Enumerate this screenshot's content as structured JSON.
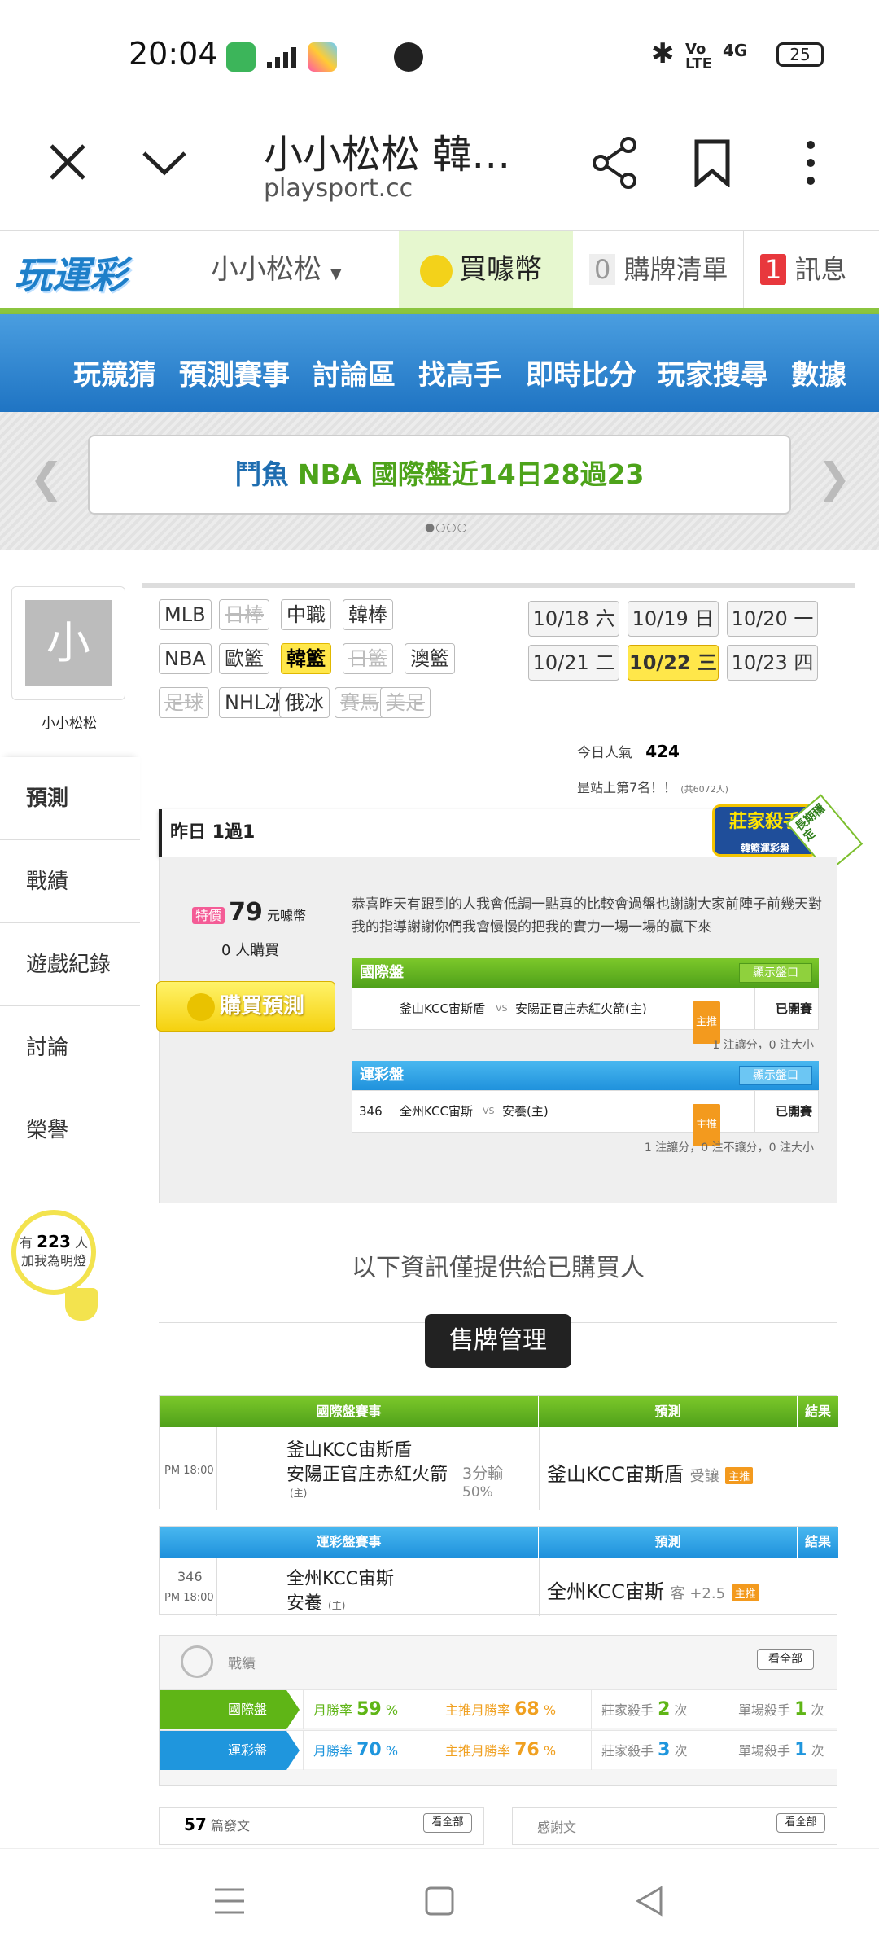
{
  "status": {
    "time": "20:04",
    "battery": "25",
    "net": "4G"
  },
  "chrome": {
    "title": "小小松松 韓…",
    "url": "playsport.cc"
  },
  "site": {
    "logo": "玩運彩",
    "username": "小小松松",
    "buy_coin": "買噱幣",
    "cart_count": "0",
    "cart_label": "購牌清單",
    "msg_count": "1",
    "msg_label": "訊息"
  },
  "nav": [
    "玩競猜",
    "預測賽事",
    "討論區",
    "找高手",
    "即時比分",
    "玩家搜尋",
    "數據"
  ],
  "promo": {
    "left": "鬥魚",
    "right": "NBA 國際盤近14日28過23"
  },
  "profile": {
    "avatar": "小",
    "name": "小小松松",
    "fans_prefix": "有",
    "fans_count": "223",
    "fans_unit": "人",
    "fans_line2": "加我為明燈"
  },
  "tabs": [
    "預測",
    "戰績",
    "遊戲紀錄",
    "討論",
    "榮譽"
  ],
  "sports": [
    {
      "label": "MLB",
      "state": "normal"
    },
    {
      "label": "日棒",
      "state": "off"
    },
    {
      "label": "中職",
      "state": "normal"
    },
    {
      "label": "韓棒",
      "state": "normal"
    },
    {
      "label": "NBA",
      "state": "normal"
    },
    {
      "label": "歐籃",
      "state": "normal"
    },
    {
      "label": "韓籃",
      "state": "on"
    },
    {
      "label": "日籃",
      "state": "off"
    },
    {
      "label": "澳籃",
      "state": "normal"
    },
    {
      "label": "足球",
      "state": "off"
    },
    {
      "label": "NHL冰球",
      "state": "normal"
    },
    {
      "label": "俄冰",
      "state": "normal"
    },
    {
      "label": "賽馬",
      "state": "off"
    },
    {
      "label": "美足",
      "state": "off"
    }
  ],
  "dates": [
    {
      "label": "10/18 六",
      "state": "normal"
    },
    {
      "label": "10/19 日",
      "state": "normal"
    },
    {
      "label": "10/20 一",
      "state": "normal"
    },
    {
      "label": "10/21 二",
      "state": "normal"
    },
    {
      "label": "10/22 三",
      "state": "on"
    },
    {
      "label": "10/23 四",
      "state": "normal"
    }
  ],
  "popularity": {
    "label": "今日人氣",
    "value": "424",
    "rank_text": "昰站上第7名！！",
    "rank_total": "(共6072人)"
  },
  "yesterday": {
    "label": "昨日 1過1",
    "badge": "莊家殺手",
    "badge_sub": "韓籃運彩盤",
    "ribbon": "長期穩定"
  },
  "offer": {
    "special": "特價",
    "price": "79",
    "unit": "元噱幣",
    "buyers": "0",
    "buyers_unit": "人購買",
    "buy_btn": "購買預測"
  },
  "message": "恭喜昨天有跟到的人我會低調一點真的比較會過盤也謝謝大家前陣子前幾天對我的指導謝謝你們我會慢慢的把我的實力一場一場的贏下來",
  "intl_block": {
    "title": "國際盤",
    "show": "顯示盤口",
    "home": "釜山KCC宙斯盾",
    "vs": "VS",
    "away": "安陽正官庄赤紅火箭(主)",
    "tag": "主推",
    "status": "已開賽",
    "note": "1 注讓分，0 注大小"
  },
  "lottery_block": {
    "title": "運彩盤",
    "show": "顯示盤口",
    "num": "346",
    "home": "全州KCC宙斯",
    "vs": "VS",
    "away": "安養(主)",
    "tag": "主推",
    "status": "已開賽",
    "note": "1 注讓分，0 注不讓分，0 注大小"
  },
  "buyers_only": "以下資訊僅提供給已購買人",
  "sell_btn": "售牌管理",
  "intl_table": {
    "h1": "國際盤賽事",
    "h2": "預測",
    "h3": "結果",
    "time": "PM 18:00",
    "team1": "釜山KCC宙斯盾",
    "team2": "安陽正官庄赤紅火箭",
    "home": "(主)",
    "line1": "3分輸",
    "line2": "50%",
    "pick": "釜山KCC宙斯盾",
    "pick_sub": "受讓",
    "tag": "主推"
  },
  "lot_table": {
    "h1": "運彩盤賽事",
    "h2": "預測",
    "h3": "結果",
    "num": "346",
    "time": "PM 18:00",
    "team1": "全州KCC宙斯",
    "team2": "安養",
    "home": "(主)",
    "pick": "全州KCC宙斯",
    "pick_sub": "客 +2.5",
    "tag": "主推"
  },
  "record": {
    "title": "戰績",
    "see_all": "看全部",
    "rows": [
      {
        "name": "國際盤",
        "m_label": "月勝率",
        "m_val": "59",
        "p_label": "主推月勝率",
        "p_val": "68",
        "k_label": "莊家殺手",
        "k_val": "2",
        "s_label": "單場殺手",
        "s_val": "1",
        "color": "#5fb516"
      },
      {
        "name": "運彩盤",
        "m_label": "月勝率",
        "m_val": "70",
        "p_label": "主推月勝率",
        "p_val": "76",
        "k_label": "莊家殺手",
        "k_val": "3",
        "s_label": "單場殺手",
        "s_val": "1",
        "color": "#1f96dd"
      }
    ],
    "pct": "%",
    "times": "次"
  },
  "bottom": {
    "posts_count": "57",
    "posts_label": "篇發文",
    "see_all": "看全部",
    "thanks": "感謝文",
    "see_all2": "看全部"
  }
}
